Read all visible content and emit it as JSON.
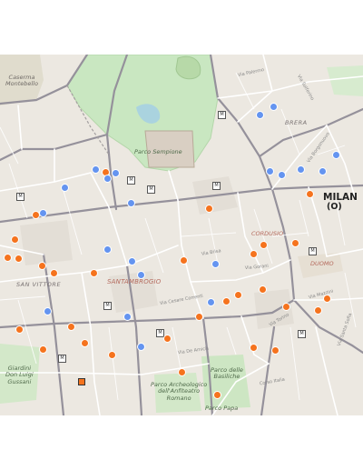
{
  "map": {
    "city_label": "MILAN",
    "city_sublabel": "(O)",
    "area_labels": {
      "caserma": "Caserma\nMontebello",
      "parco_sempione": "Parco Sempione",
      "brera": "BRERA",
      "cordusio": "CORDUSIO",
      "duomo": "DUOMO",
      "santambrogio": "SANTAMBROGIO",
      "san_vittore": "SAN VITTORE",
      "giardini": "Giardini\nDon Luigi\nGussani",
      "parco_archeologico": "Parco Archeologico\ndell'Anfiteatro\nRomano",
      "parco_basiliche": "Parco delle\nBasiliche",
      "parco_papa": "Parco Papa"
    },
    "street_labels": {
      "via_palermo": "Via Palermo",
      "via_solferino": "Via Solferino",
      "via_borgonuovo": "Via Borgonuovo",
      "via_brisa": "Via Brisa",
      "via_gorani": "Via Gorani",
      "via_santa_sofia": "Via Santa Sofia",
      "via_mazzini": "Via Mazzini",
      "corso_italia": "Corso Italia",
      "via_torino": "Via Torino",
      "via_cesare_correnti": "Via Cesare Correnti",
      "via_de_amicis": "Via De Amicis"
    },
    "marker_colors": {
      "orange": "#f5731e",
      "blue": "#6494f0"
    }
  }
}
